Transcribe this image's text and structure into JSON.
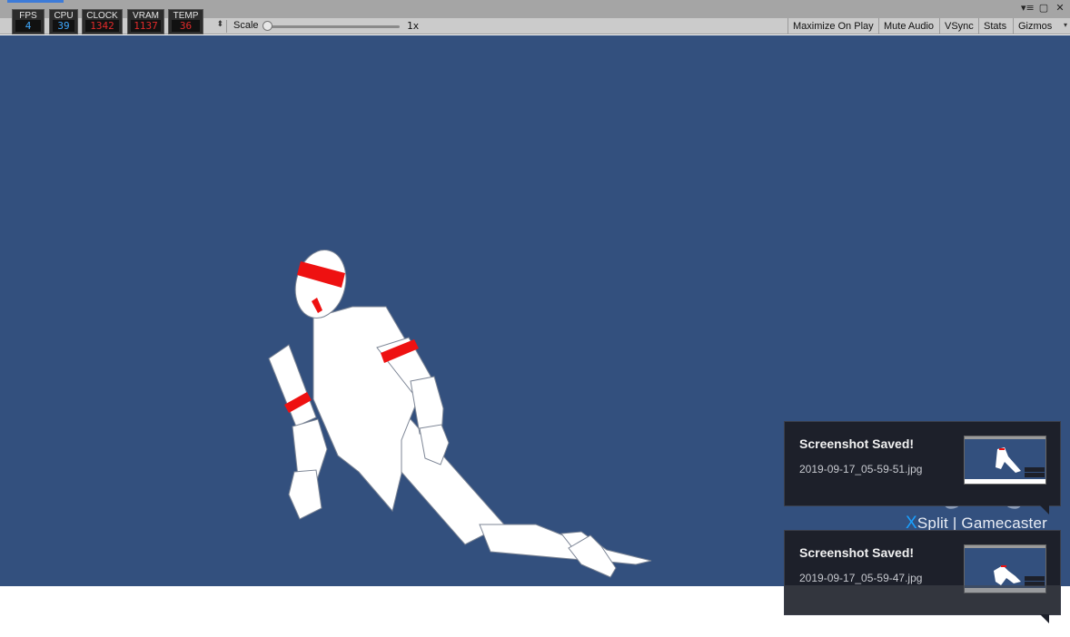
{
  "window": {
    "controls": [
      "▾≡",
      "▢",
      "✕"
    ]
  },
  "toolbar": {
    "scale_label": "Scale",
    "scale_value": "1x",
    "buttons": [
      "Maximize On Play",
      "Mute Audio",
      "VSync",
      "Stats",
      "Gizmos"
    ]
  },
  "perf": [
    {
      "label": "FPS",
      "value": "4",
      "color": "#3fa9ff"
    },
    {
      "label": "CPU",
      "value": "39",
      "color": "#3fa9ff"
    },
    {
      "label": "CLOCK",
      "value": "1342",
      "color": "#e22a2a"
    },
    {
      "label": "VRAM",
      "value": "1137",
      "color": "#e22a2a"
    },
    {
      "label": "TEMP",
      "value": "36",
      "color": "#e22a2a"
    }
  ],
  "colors": {
    "game_background": "#33507e",
    "marker_red": "#ee1111",
    "notif_background": "#1d202a",
    "brand_accent": "#1aa0ff"
  },
  "notifications": [
    {
      "title": "Screenshot Saved!",
      "filename": "2019-09-17_05-59-51.jpg"
    },
    {
      "title": "Screenshot Saved!",
      "filename": "2019-09-17_05-59-47.jpg"
    }
  ],
  "brand": {
    "x": "X",
    "name": "Split | Gamecaster",
    "icon": "gamepad-icon"
  }
}
